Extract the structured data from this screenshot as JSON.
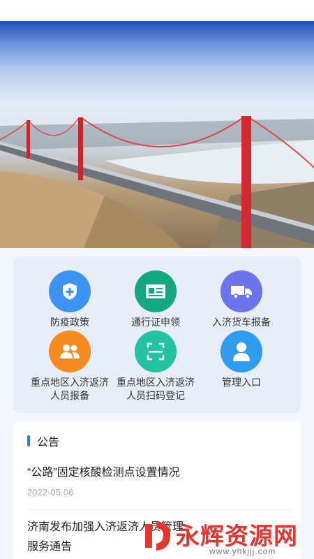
{
  "functions": [
    {
      "label": "防疫政策",
      "icon": "shield-plus-icon",
      "color": "#3d93f2"
    },
    {
      "label": "通行证申领",
      "icon": "id-card-icon",
      "color": "#14a87f"
    },
    {
      "label": "入济货车报备",
      "icon": "truck-icon",
      "color": "#6b74ea"
    },
    {
      "label": "重点地区入济返济人员报备",
      "line1": "重点地区入济返济",
      "line2": "人员报备",
      "icon": "users-icon",
      "color": "#f58a1f"
    },
    {
      "label": "重点地区入济返济人员扫码登记",
      "line1": "重点地区入济返济",
      "line2": "人员扫码登记",
      "icon": "scan-icon",
      "color": "#22c2a4"
    },
    {
      "label": "管理入口",
      "icon": "admin-user-icon",
      "color": "#2f9cf0"
    }
  ],
  "notice": {
    "title": "公告",
    "items": [
      {
        "title": "“公路”固定核酸检测点设置情况",
        "date": "2022-05-06"
      },
      {
        "title_line1": "济南发布加强入济返济人员管理",
        "title_line2": "服务通告"
      }
    ]
  },
  "watermark": {
    "main": "永辉资源网",
    "sub": "www.yhkjjj.com"
  }
}
